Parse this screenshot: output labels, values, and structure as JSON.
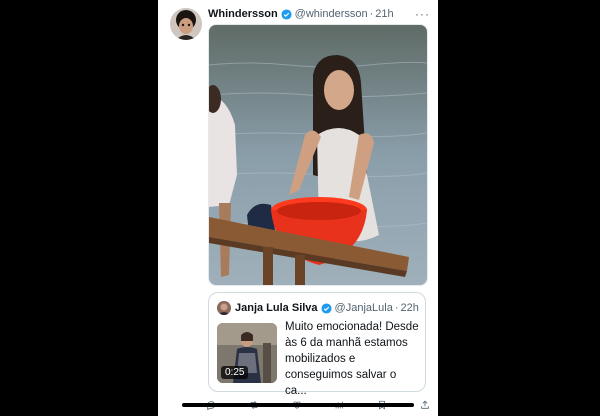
{
  "post": {
    "author_name": "Whindersson",
    "author_handle": "@whindersson",
    "separator": "·",
    "time": "21h",
    "more_glyph": "···"
  },
  "quoted_post": {
    "author_name": "Janja Lula Silva",
    "author_handle": "@JanjaLula",
    "separator": "·",
    "time": "22h",
    "text": "Muito emocionada! Desde às 6 da manhã estamos mobilizados e conseguimos salvar o ca...",
    "video_duration": "0:25"
  },
  "colors": {
    "verified": "#1d9bf0",
    "basin": "#e8321c",
    "water": "#8a9eaa"
  },
  "icons": [
    "verified-badge-icon",
    "more-icon",
    "reply-icon",
    "retweet-icon",
    "like-icon",
    "views-icon",
    "bookmark-icon",
    "share-icon"
  ]
}
